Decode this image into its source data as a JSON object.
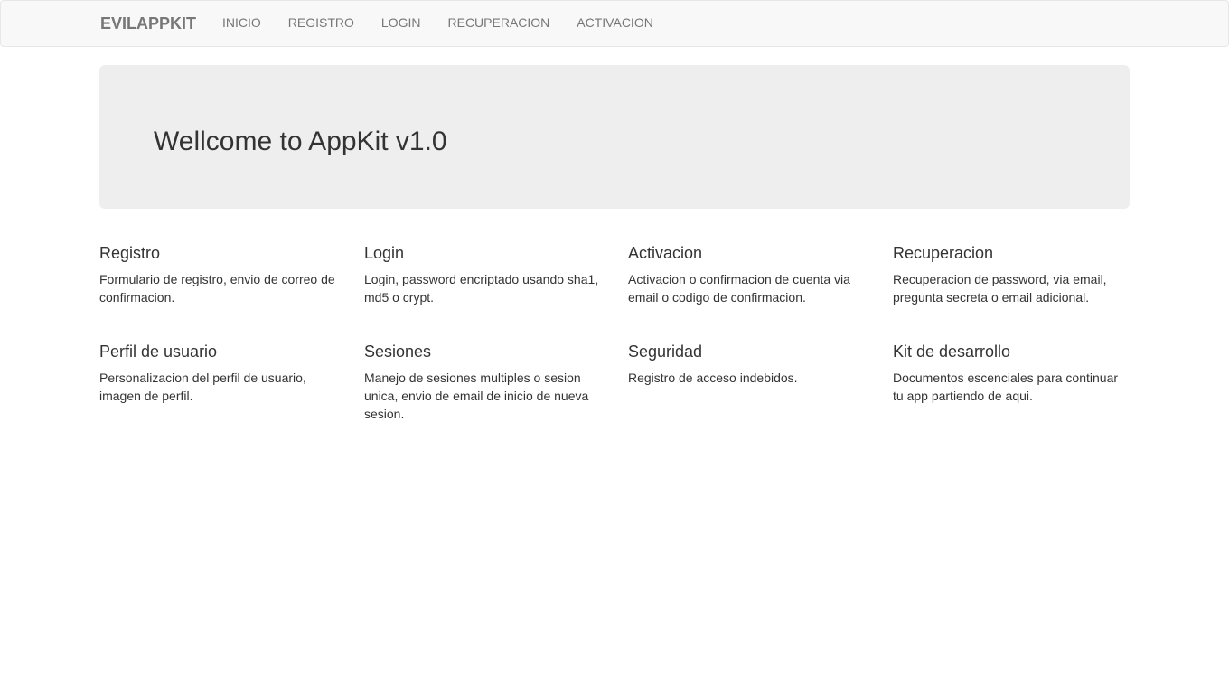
{
  "navbar": {
    "brand": "EVILAPPKIT",
    "links": [
      "INICIO",
      "REGISTRO",
      "LOGIN",
      "RECUPERACION",
      "ACTIVACION"
    ]
  },
  "jumbotron": {
    "title": "Wellcome to AppKit v1.0"
  },
  "features": [
    {
      "title": "Registro",
      "text": "Formulario de registro, envio de correo de confirmacion."
    },
    {
      "title": "Login",
      "text": "Login, password encriptado usando sha1, md5 o crypt."
    },
    {
      "title": "Activacion",
      "text": "Activacion o confirmacion de cuenta via email o codigo de confirmacion."
    },
    {
      "title": "Recuperacion",
      "text": "Recuperacion de password, via email, pregunta secreta o email adicional."
    },
    {
      "title": "Perfil de usuario",
      "text": "Personalizacion del perfil de usuario, imagen de perfil."
    },
    {
      "title": "Sesiones",
      "text": "Manejo de sesiones multiples o sesion unica, envio de email de inicio de nueva sesion."
    },
    {
      "title": "Seguridad",
      "text": "Registro de acceso indebidos."
    },
    {
      "title": "Kit de desarrollo",
      "text": "Documentos escenciales para continuar tu app partiendo de aqui."
    }
  ]
}
